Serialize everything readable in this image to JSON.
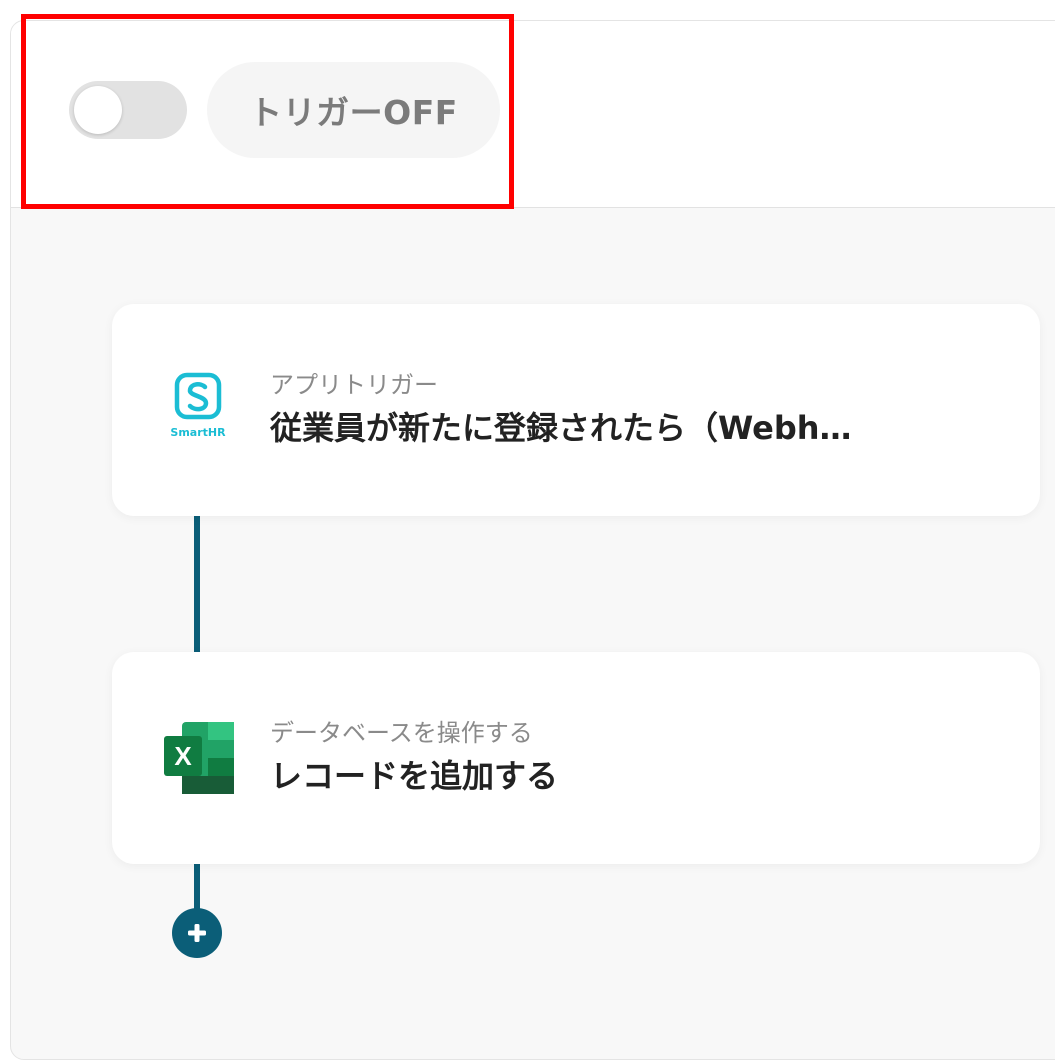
{
  "header": {
    "trigger_status": "トリガーOFF"
  },
  "steps": [
    {
      "kind": "アプリトリガー",
      "title": "従業員が新たに登録されたら（Webh…",
      "icon": "smarthr-icon",
      "icon_caption": "SmartHR"
    },
    {
      "kind": "データベースを操作する",
      "title": "レコードを追加する",
      "icon": "excel-icon",
      "icon_letter": "X"
    }
  ],
  "colors": {
    "highlight": "#ff0000",
    "connector": "#0b5e78",
    "smarthr": "#1bbdd4",
    "excel": "#107c41"
  }
}
